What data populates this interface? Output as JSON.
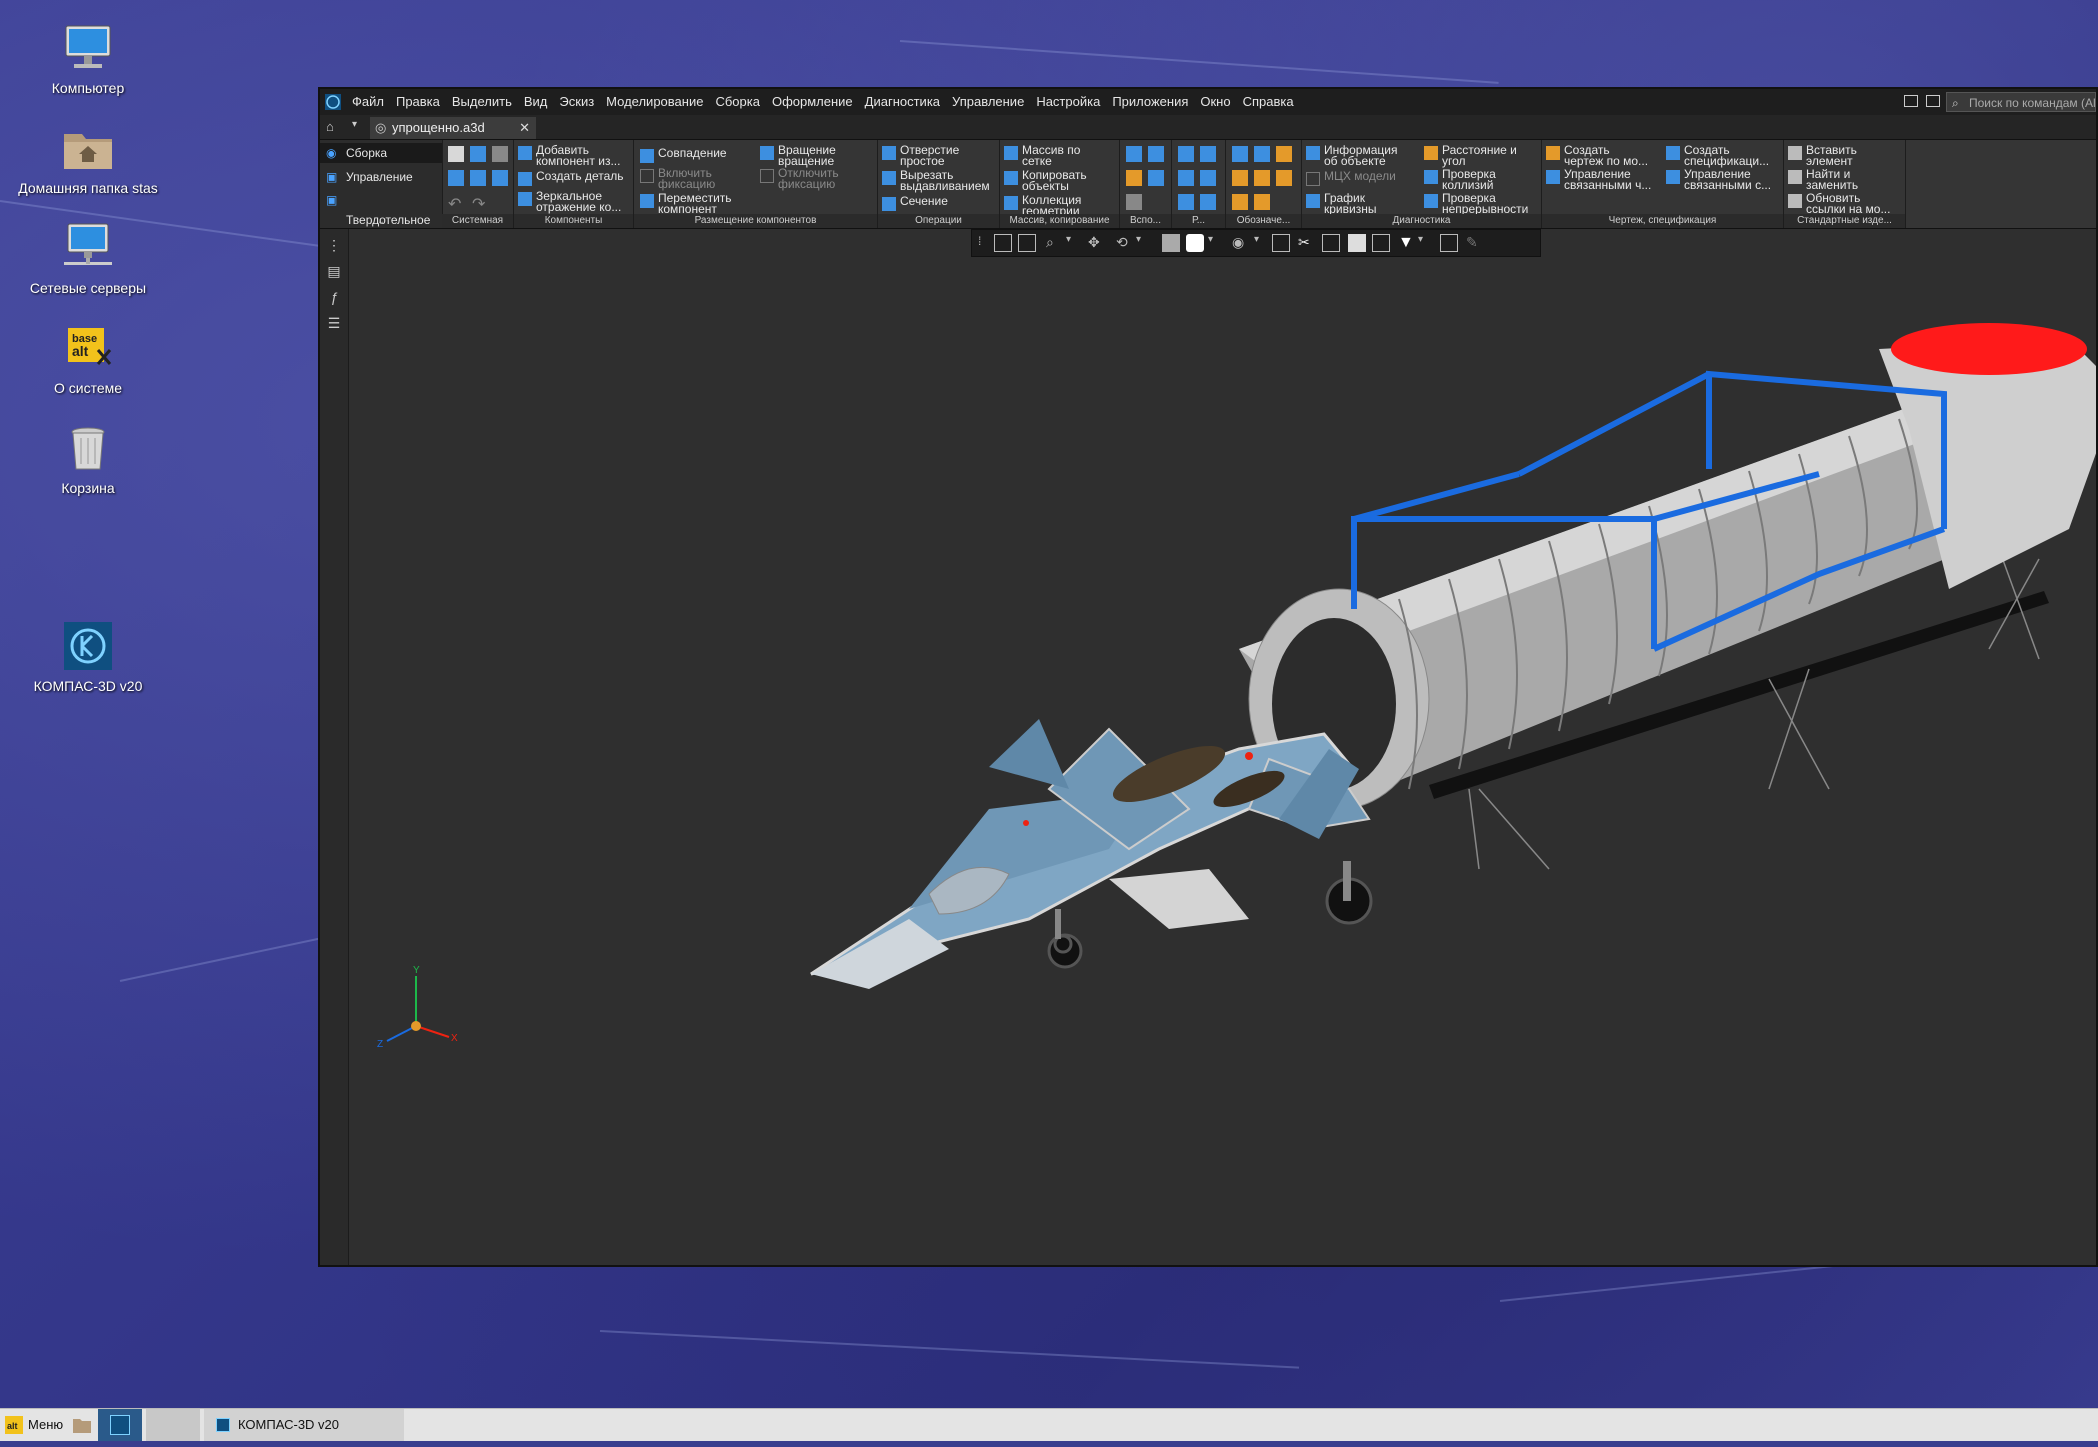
{
  "desktop": {
    "icons": [
      {
        "label": "Компьютер"
      },
      {
        "label": "Домашняя папка stas"
      },
      {
        "label": "Сетевые серверы"
      },
      {
        "label": "О системе"
      },
      {
        "label": "Корзина"
      },
      {
        "label": "КОМПАС-3D v20"
      }
    ],
    "about_icon_text": "base alt",
    "colors": {
      "wallpaper": "#3a3e8e"
    }
  },
  "app": {
    "menu": [
      "Файл",
      "Правка",
      "Выделить",
      "Вид",
      "Эскиз",
      "Моделирование",
      "Сборка",
      "Оформление",
      "Диагностика",
      "Управление",
      "Настройка",
      "Приложения",
      "Окно",
      "Справка"
    ],
    "search_placeholder": "Поиск по командам (Al",
    "document_tab": "упрощенно.a3d",
    "modes": [
      "Сборка",
      "Управление",
      "Твердотельное\nмоделирование"
    ],
    "ribbon_groups": [
      {
        "name": "Системная"
      },
      {
        "name": "Компоненты",
        "buttons": [
          "Добавить\nкомпонент из...",
          "Создать деталь",
          "Зеркальное\nотражение ко..."
        ]
      },
      {
        "name": "Размещение компонентов",
        "buttons": [
          "Совпадение",
          "Включить\nфиксацию",
          "Переместить\nкомпонент",
          "Вращение\nвращение",
          "Отключить\nфиксацию"
        ]
      },
      {
        "name": "Операции",
        "buttons": [
          "Отверстие\nпростое",
          "Вырезать\nвыдавливанием",
          "Сечение"
        ]
      },
      {
        "name": "Массив, копирование",
        "buttons": [
          "Массив по\nсетке",
          "Копировать\nобъекты",
          "Коллекция\nгеометрии"
        ]
      },
      {
        "name": "Вспо..."
      },
      {
        "name": "Р..."
      },
      {
        "name": "Обозначе..."
      },
      {
        "name": "Диагностика",
        "buttons": [
          "Информация\nоб объекте",
          "МЦХ модели",
          "График\nкривизны",
          "Расстояние и\nугол",
          "Проверка\nколлизий",
          "Проверка\nнепрерывности"
        ]
      },
      {
        "name": "Чертеж, спецификация",
        "buttons": [
          "Создать\nчертеж по мо...",
          "Управление\nсвязанными ч...",
          "Создать\nспецификаци...",
          "Управление\nсвязанными с..."
        ]
      },
      {
        "name": "Стандартные изде...",
        "buttons": [
          "Вставить\nэлемент",
          "Найти и\nзаменить",
          "Обновить\nссылки на мо..."
        ]
      }
    ],
    "axes": {
      "x": "X",
      "y": "Y",
      "z": "Z"
    },
    "colors": {
      "accent": "#1f6fd0",
      "viewport_bg": "#2f2f2f",
      "jet": "#7fa6c4",
      "frame_blue": "#1a6be0",
      "nozzle_red": "#ff1a1a",
      "rail_green": "#1db84a"
    }
  },
  "taskbar": {
    "menu_label": "Меню",
    "task_label": "КОМПАС-3D v20"
  }
}
